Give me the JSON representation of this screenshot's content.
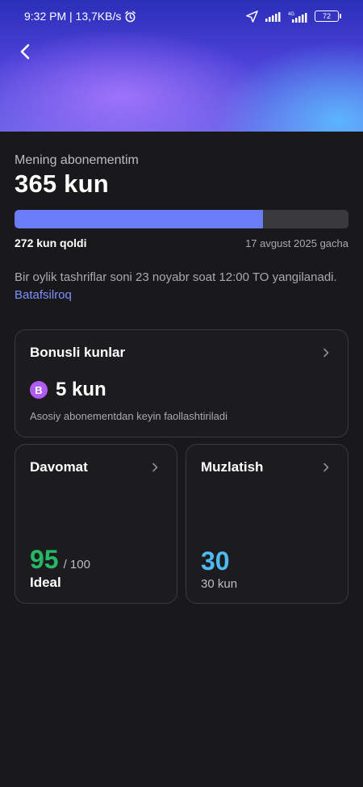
{
  "status_bar": {
    "time_speed": "9:32 PM | 13,7KB/s",
    "battery": "72",
    "network": "4G"
  },
  "header": {
    "back_icon": "chevron-left-icon"
  },
  "subscription": {
    "label": "Mening abonementim",
    "total": "365 kun",
    "progress_fraction": 0.745,
    "days_left": "272 kun qoldi",
    "until": "17 avgust 2025 gacha",
    "info": "Bir oylik tashriflar soni 23 noyabr soat 12:00 TO yangilanadi.",
    "link": "Batafsilroq"
  },
  "bonus": {
    "title": "Bonusli kunlar",
    "badge": "B",
    "value": "5 kun",
    "note": "Asosiy abonementdan keyin faollashtiriladi"
  },
  "attendance": {
    "title": "Davomat",
    "score": "95",
    "max": "/ 100",
    "label": "Ideal"
  },
  "freeze": {
    "title": "Muzlatish",
    "value": "30",
    "sub": "30 kun"
  },
  "colors": {
    "accent_blue": "#6b7cf7",
    "link": "#7f90ff",
    "score_green": "#27b865",
    "freeze_cyan": "#4fb9f2",
    "bonus_badge": "#b05cf0",
    "background": "#19191b"
  }
}
